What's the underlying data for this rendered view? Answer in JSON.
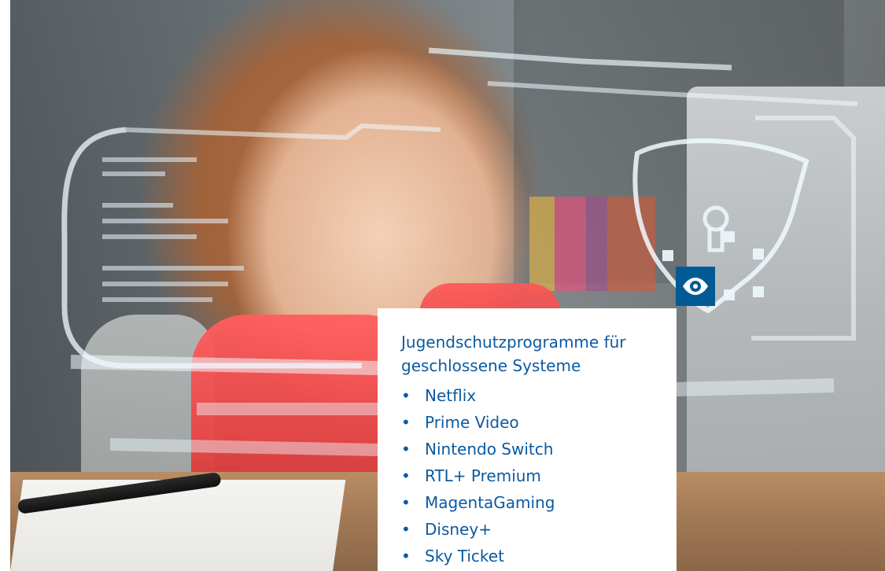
{
  "card": {
    "title_line1": "Jugendschutzprogramme für",
    "title_line2": "geschlossene Systeme",
    "items": [
      "Netflix",
      "Prime Video",
      "Nintendo Switch",
      "RTL+ Premium",
      "MagentaGaming",
      "Disney+",
      "Sky Ticket"
    ]
  },
  "icons": {
    "badge_icon": "eye-icon",
    "overlay_icon": "shield-lock-icon"
  },
  "colors": {
    "brand_blue": "#0b5aa0",
    "badge_blue": "#005b94"
  }
}
